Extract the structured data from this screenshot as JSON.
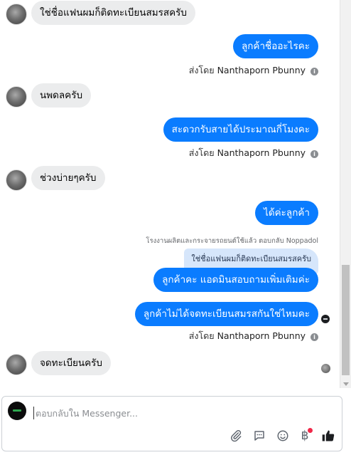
{
  "messages": [
    {
      "text": "ใช่ชื่อแฟนผมก็ติดทะเบียนสมรสครับ"
    },
    {
      "text": "ลูกค้าชื่ออะไรคะ"
    },
    {
      "text": "นพดลครับ"
    },
    {
      "text": "สะดวกรับสายได้ประมาณกี่โมงคะ"
    },
    {
      "text": "ช่วงบ่ายๆครับ"
    },
    {
      "text": "ได้ค่ะลูกค้า"
    },
    {
      "text": "ลูกค้าคะ แอดมินสอบถามเพิ่มเติมค่ะ"
    },
    {
      "text": "ลูกค้าไม่ได้จดทะเบียนสมรสกันใช่ไหมคะ"
    },
    {
      "text": "จดทะเบียนครับ"
    }
  ],
  "sent_by": {
    "prefix": "ส่งโดย",
    "name": "Nanthaporn Pbunny"
  },
  "reply_note": "โรงงานผลิตและกระจายรถยนต์ใช้แล้ว ตอบกลับ Noppadol",
  "quoted_text": "ใช่ชื่อแฟนผมก็ติดทะเบียนสมรสครับ",
  "composer": {
    "placeholder": "ตอบกลับใน Messenger..."
  },
  "icons": {
    "info": "i",
    "currency_symbol": "฿"
  },
  "colors": {
    "outgoing": "#0a7cff",
    "incoming": "#ebeced",
    "quoted": "#d6e6fb",
    "like": "#1c1e21"
  }
}
